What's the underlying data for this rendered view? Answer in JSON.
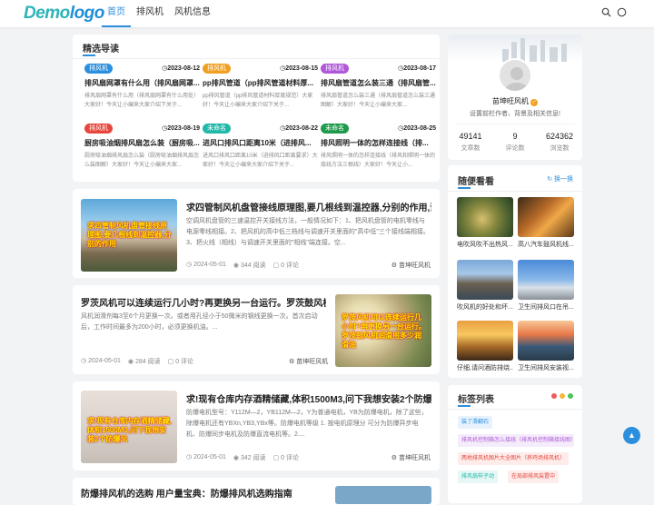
{
  "header": {
    "logo_main": "Demo",
    "logo_tail": "logo",
    "nav": [
      "首页",
      "排风机",
      "风机信息"
    ],
    "icons": [
      "search-icon",
      "theme-toggle-icon"
    ]
  },
  "guide": {
    "title": "精选导读",
    "items": [
      {
        "tag": "排风机",
        "tag_color": "#2c8fde",
        "date": "2023-08-12",
        "title": "排风扇网罩有什么用（排风扇网罩...",
        "desc": "排风扇网罩有什么用（排风扇网罩有什么用处）大家好！今天让小编来大家介绍下关于..."
      },
      {
        "tag": "排风机",
        "tag_color": "#f0a020",
        "date": "2023-08-15",
        "title": "pp排风管道（pp排风管道材料厚...",
        "desc": "pp排风管道（pp排风管道材料厚度规范）大家好！今天让小编来大家介绍下关于..."
      },
      {
        "tag": "排风机",
        "tag_color": "#b058d8",
        "date": "2023-08-17",
        "title": "排风扇管道怎么装三通（排风扇管...",
        "desc": "排风扇管道怎么装三通（排风扇管道怎么装三通图解）大家好！今天让小编来大家..."
      },
      {
        "tag": "排风机",
        "tag_color": "#e8463c",
        "date": "2023-08-19",
        "title": "厨房吸油烟排风扇怎么装（厨房吸...",
        "desc": "厨房吸油烟排风扇怎么装（厨房吸油烟排风扇怎么装图解）大家好！今天让小编来大家..."
      },
      {
        "tag": "未命名",
        "tag_color": "#20b8a8",
        "date": "2023-08-22",
        "title": "进风口排风口距离10米（进排风...",
        "desc": "进风口排风口距离10米（进排风口距离要求）大家好！今天让小编来大家介绍下关于..."
      },
      {
        "tag": "未命名",
        "tag_color": "#1e9a4a",
        "date": "2023-08-25",
        "title": "排风照明一体的怎样连接线（排...",
        "desc": "排风照明一体的怎样连接线（排风和照明一体的接线方法三根线）大家好！今天让小..."
      }
    ]
  },
  "articles": [
    {
      "title": "求四管制风机盘管接线原理图,要几根线到温控器,分别的作用,谢谢...",
      "desc": "空调风机盘管的三速温控开关接线方法，一般情况如下：1、把风机盘管的电机零线与电源零线相接。2、把风机的高中低三档线与调速开关里面的\"高中低\"三个接线端相接。3、把火线（相线）与调速开关里面的\"相线\"端连接。空...",
      "date": "2024-05-01",
      "views": "344 阅读",
      "comments": "0 评论",
      "author": "苗坤旺风机",
      "overlay": "求四管制风机盘管接线原理图,要几根线到温控器,分别的作用"
    },
    {
      "title": "罗茨风机可以连续运行几小时?再更换另一台运行。罗茨鼓风机润...",
      "desc": "风机润滑剂每3至6个月更换一次。或者用孔径小于50微米的钢线更换一次。首次启动后，工作时间最多为200小时，必须更换机油。...",
      "date": "2024-05-01",
      "views": "284 阅读",
      "comments": "0 评论",
      "author": "苗坤旺风机",
      "overlay": "罗茨风机可以连续运行几小时?再更换另一台运行。罗茨鼓风机润滑用多少润滑油"
    },
    {
      "title": "求!现有仓库内存酒精储藏,体积1500M3,问下我想安装2个防爆风...",
      "desc": "防爆电机型号：Y112M—2，YB112M—2，Y为普通电机，YB为防爆电机，除了这些，除爆电机还有YBXn,YB3,YBx等。防爆电机等级 1. 按电机原理分 可分为防爆异步电机、防爆同步电机及防爆直流电机等。2....",
      "date": "2024-05-01",
      "views": "342 阅读",
      "comments": "0 评论",
      "author": "苗坤旺风机",
      "overlay": "求!现有仓库内存酒精储藏,体积1500M3,问下我想安装2个防爆风"
    },
    {
      "title": "防爆排风机的选购 用户量宝典：防爆排风机选购指南"
    }
  ],
  "profile": {
    "name": "苗坤旺风机",
    "bio": "设置前栏作者、背景及相关信息!",
    "stats": [
      {
        "num": "49141",
        "label": "文章数"
      },
      {
        "num": "9",
        "label": "评论数"
      },
      {
        "num": "624362",
        "label": "浏览数"
      }
    ]
  },
  "recommend": {
    "title": "随便看看",
    "refresh": "换一换",
    "items": [
      {
        "caption": "电吹风吹不出热风..."
      },
      {
        "caption": "高八汽车鼓风机线..."
      },
      {
        "caption": "吹风机的好处和坏..."
      },
      {
        "caption": "卫生间排风口在吊..."
      },
      {
        "caption": "仔细,请问酒防排烧..."
      },
      {
        "caption": "卫生间排风安装视..."
      }
    ]
  },
  "tags": {
    "title": "标签列表",
    "items": [
      {
        "label": "装了滑翻石",
        "color": "#2c8fde",
        "bg": "#e8f2fc"
      },
      {
        "label": "排风机控制箱怎么接线（排风机控制箱接线图）",
        "color": "#b058d8",
        "bg": "#f5ecfb"
      },
      {
        "label": "两地排风机图片大全图片（养鸡场排风机）",
        "color": "#e8463c",
        "bg": "#fdecea"
      },
      {
        "label": "排风扇样子动",
        "color": "#20b8a8",
        "bg": "#e6f7f5"
      },
      {
        "label": "在局部排风装置中",
        "color": "#e8463c",
        "bg": "#fdecea"
      }
    ]
  }
}
